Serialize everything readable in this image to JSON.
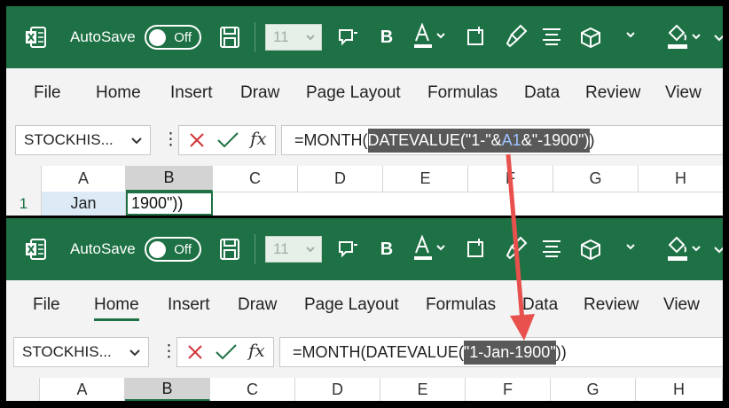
{
  "app": {
    "autosave_label": "AutoSave",
    "toggle_state": "Off",
    "font_size": "11",
    "theme_color": "#1e7145"
  },
  "icons": [
    "excel-logo-icon",
    "save-icon",
    "comment-icon",
    "bold-icon",
    "font-color-icon",
    "borders-icon",
    "format-painter-icon",
    "align-icon",
    "3d-box-icon",
    "fill-color-icon"
  ],
  "menu": [
    "File",
    "Home",
    "Insert",
    "Draw",
    "Page Layout",
    "Formulas",
    "Data",
    "Review",
    "View"
  ],
  "top": {
    "name_box": "STOCKHIS...",
    "formula": {
      "prefix": "=MONTH(",
      "hl_1": "DATEVALUE(\"1-\"&",
      "hl_ref": "A1",
      "hl_2": "&\"-1900\")",
      "suffix": ")"
    },
    "columns": [
      "A",
      "B",
      "C",
      "D",
      "E",
      "F",
      "G",
      "H"
    ],
    "row_number": "1",
    "cell_a1": "Jan",
    "cell_b1": "1900\"))"
  },
  "bottom": {
    "name_box": "STOCKHIS...",
    "active_menu": "Home",
    "formula": {
      "prefix": "=MONTH(DATEVALUE(",
      "hl": "\"1-Jan-1900\"",
      "suffix": "))"
    },
    "columns": [
      "A",
      "B",
      "C",
      "D",
      "E",
      "F",
      "G",
      "H"
    ]
  },
  "arrow_color": "#e8504d"
}
